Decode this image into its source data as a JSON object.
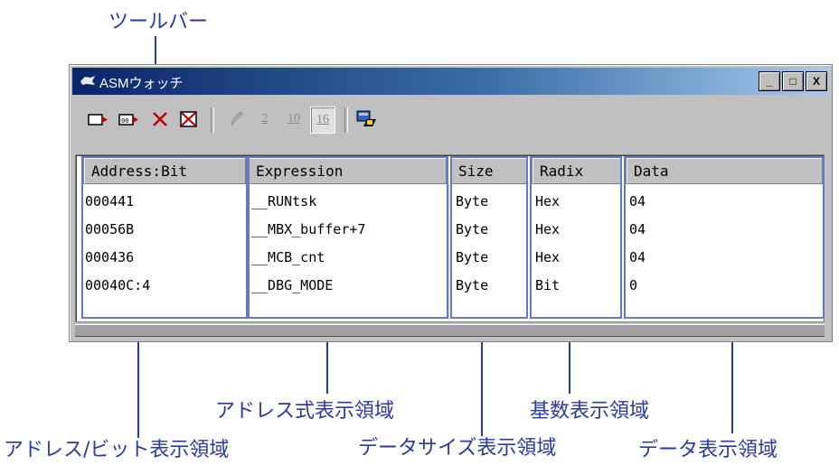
{
  "annotations": {
    "toolbar": "ツールバー",
    "address_area": "アドレス/ビット表示領域",
    "expression_area": "アドレス式表示領域",
    "size_area": "データサイズ表示領域",
    "radix_area": "基数表示領域",
    "data_area": "データ表示領域"
  },
  "window": {
    "title": "ASMウォッチ",
    "buttons": {
      "minimize": "_",
      "maximize": "□",
      "close": "X"
    }
  },
  "toolbar": {
    "radix_buttons": [
      "2",
      "10",
      "16"
    ],
    "icons": [
      "add-watch-icon",
      "add-watch-scope-icon",
      "delete-icon",
      "delete-all-icon",
      "edit-pencil-icon",
      "refresh-icon"
    ]
  },
  "table": {
    "headers": [
      "Address:Bit",
      "Expression",
      "Size",
      "Radix",
      "Data"
    ],
    "rows": [
      {
        "address": "000441",
        "expression": "__RUNtsk",
        "size": "Byte",
        "radix": "Hex",
        "data": "04"
      },
      {
        "address": "00056B",
        "expression": "__MBX_buffer+7",
        "size": "Byte",
        "radix": "Hex",
        "data": "04"
      },
      {
        "address": "000436",
        "expression": "__MCB_cnt",
        "size": "Byte",
        "radix": "Hex",
        "data": "04"
      },
      {
        "address": "00040C:4",
        "expression": "__DBG_MODE",
        "size": "Byte",
        "radix": "Bit",
        "data": "0"
      }
    ]
  },
  "colors": {
    "annotation": "#2a3a9e",
    "frame": "#6a78c8",
    "titlebar": "#0a246a"
  }
}
